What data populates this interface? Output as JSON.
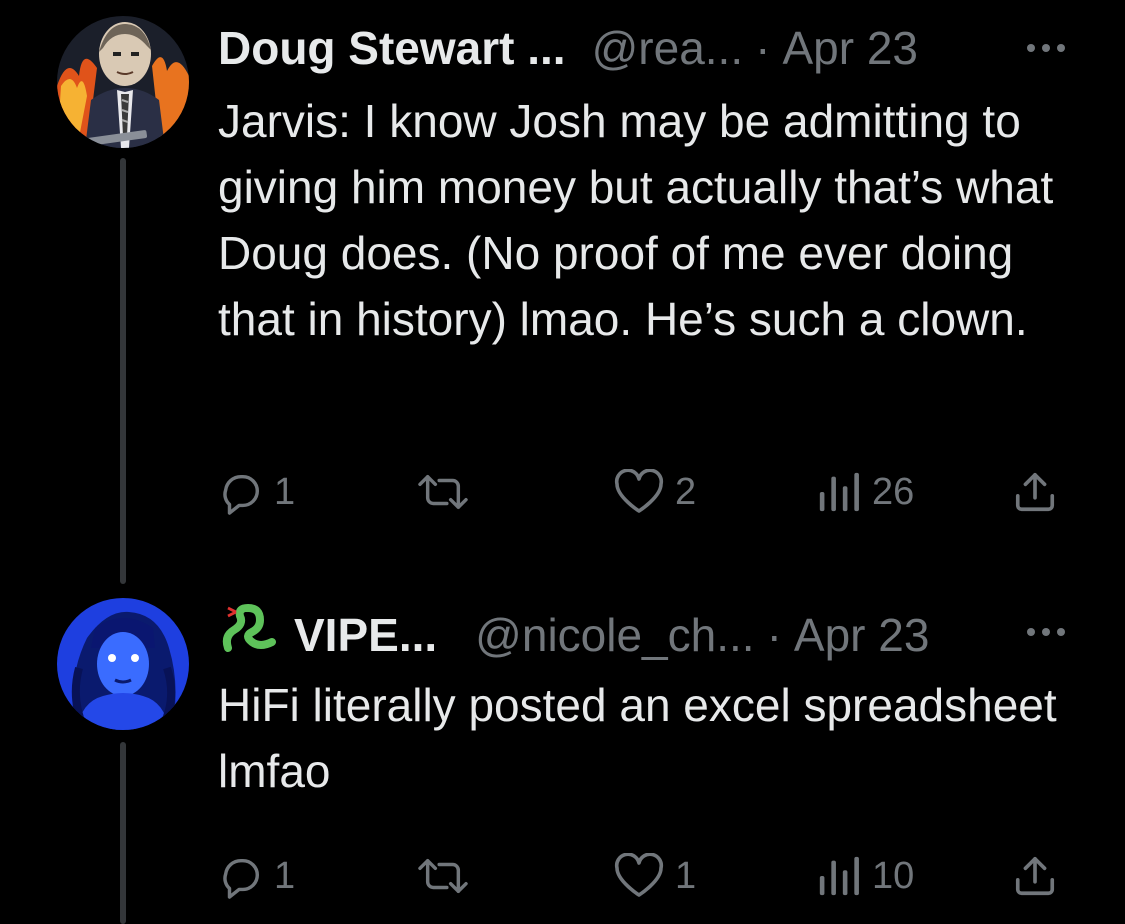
{
  "thread": [
    {
      "author_name": "Doug Stewart ...",
      "handle": "@rea...",
      "separator": "·",
      "date": "Apr 23",
      "text": "Jarvis: I know Josh may be admitting to giving him money but actually that’s what Doug does. (No proof of me ever doing that in history) lmao. He’s such a clown.",
      "replies": "1",
      "retweets": "",
      "likes": "2",
      "views": "26"
    },
    {
      "author_name": "VIPE...",
      "handle": "@nicole_ch...",
      "separator": "·",
      "date": "Apr 23",
      "text": "HiFi literally posted an excel spreadsheet lmfao",
      "replies": "1",
      "retweets": "",
      "likes": "1",
      "views": "10"
    }
  ],
  "colors": {
    "background": "#000000",
    "primary_text": "#e7e9ea",
    "secondary_text": "#71767b",
    "thread_line": "#333639",
    "snake_badge": "#5ec25a"
  },
  "icons": [
    "reply-icon",
    "retweet-icon",
    "like-icon",
    "views-icon",
    "share-icon",
    "more-icon",
    "snake-emoji-icon"
  ]
}
